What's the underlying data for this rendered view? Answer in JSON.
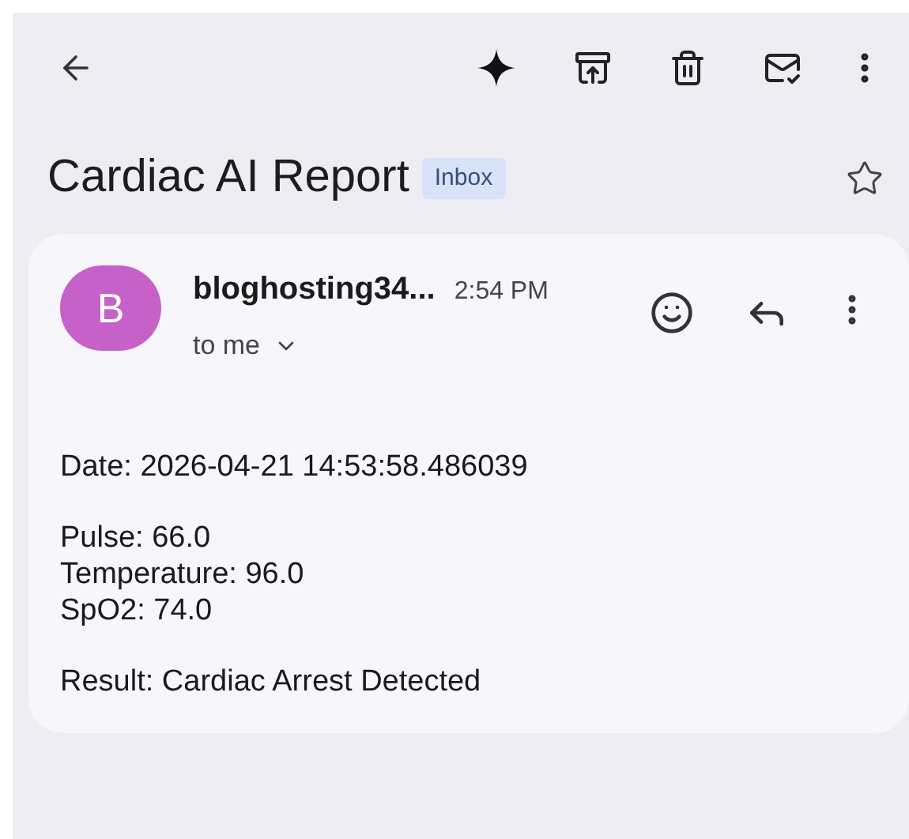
{
  "subject": "Cardiac AI Report",
  "label": "Inbox",
  "starred": false,
  "message": {
    "avatar_letter": "B",
    "color": "#c561c9",
    "sender": "bloghosting34...",
    "time": "2:54 PM",
    "recipient": "to me",
    "body": [
      [
        "Date: 2026-04-21 14:53:58.486039"
      ],
      [
        "Pulse: 66.0",
        "Temperature: 96.0",
        "SpO2: 74.0"
      ],
      [
        "Result: Cardiac Arrest Detected"
      ]
    ]
  }
}
